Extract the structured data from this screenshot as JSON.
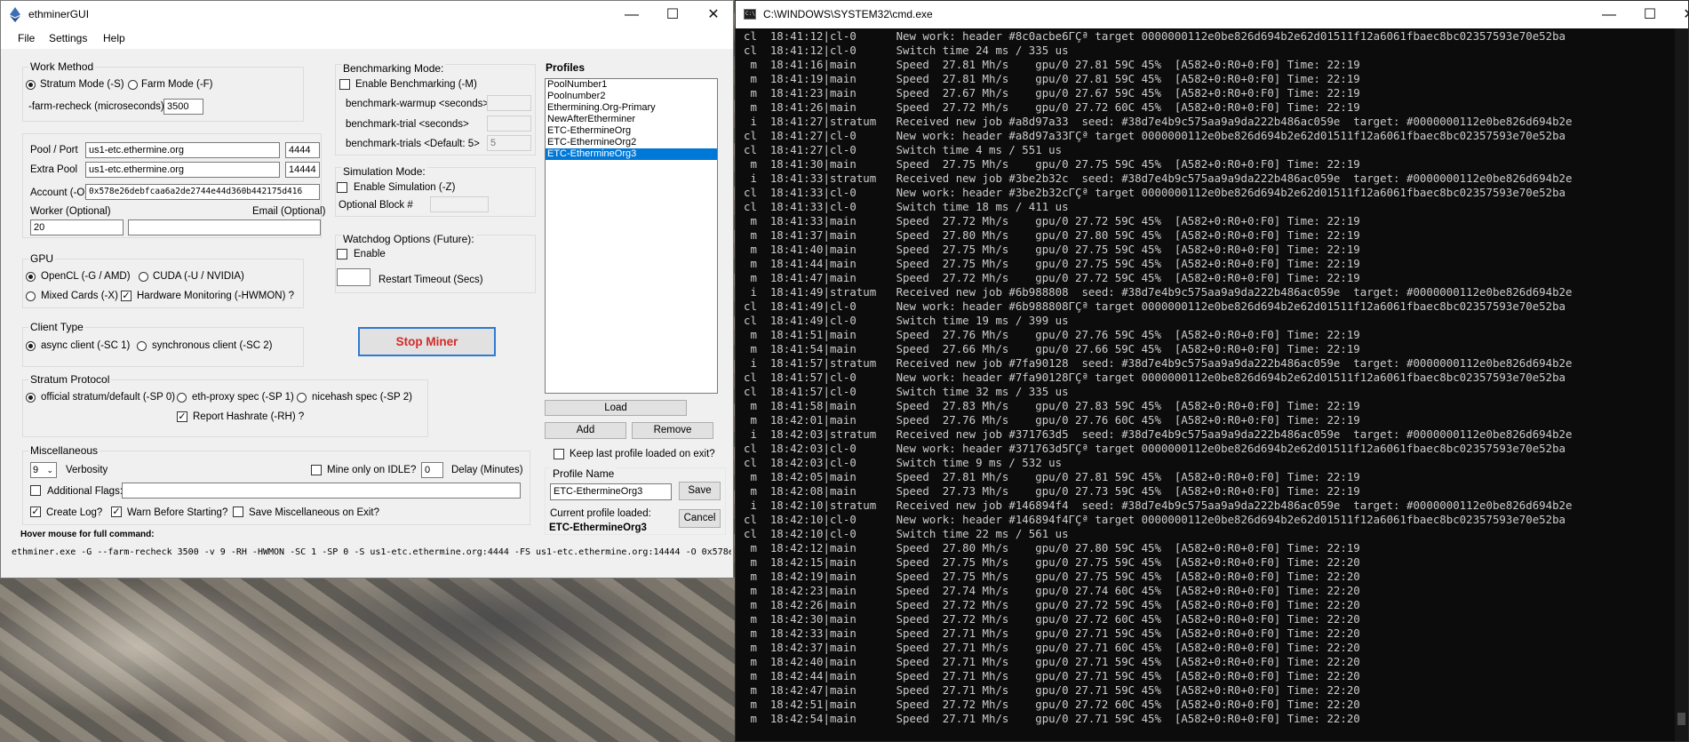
{
  "app": {
    "title": "ethminerGUI",
    "menu": [
      "File",
      "Settings",
      "Help"
    ],
    "window_buttons": {
      "minimize": "—",
      "maximize": "☐",
      "close": "✕"
    }
  },
  "work_method": {
    "title": "Work Method",
    "stratum_label": "Stratum Mode (-S)",
    "stratum_selected": true,
    "farm_label": "Farm Mode (-F)",
    "farm_selected": false,
    "recheck_label": "-farm-recheck (microseconds)",
    "recheck_value": "3500"
  },
  "pool": {
    "pool_label": "Pool / Port",
    "pool_value": "us1-etc.ethermine.org",
    "pool_port": "4444",
    "extra_label": "Extra Pool",
    "extra_value": "us1-etc.ethermine.org",
    "extra_port": "14444",
    "account_label": "Account (-O)",
    "account_value": "0x578e26debfcaa6a2de2744e44d360b442175d416",
    "worker_label": "Worker (Optional)",
    "worker_value": "20",
    "email_label": "Email (Optional)",
    "email_value": ""
  },
  "gpu": {
    "title": "GPU",
    "opencl_label": "OpenCL (-G / AMD)",
    "opencl_selected": true,
    "cuda_label": "CUDA (-U / NVIDIA)",
    "cuda_selected": false,
    "mixed_label": "Mixed Cards (-X)",
    "mixed_selected": false,
    "hwmon_label": "Hardware Monitoring (-HWMON) ?",
    "hwmon_checked": true
  },
  "client_type": {
    "title": "Client Type",
    "async_label": "async client (-SC 1)",
    "async_selected": true,
    "sync_label": "synchronous client (-SC 2)",
    "sync_selected": false
  },
  "stratum_protocol": {
    "title": "Stratum Protocol",
    "official_label": "official stratum/default (-SP 0)",
    "official_selected": true,
    "ethproxy_label": "eth-proxy spec (-SP 1)",
    "nicehash_label": "nicehash spec (-SP 2)",
    "report_label": "Report Hashrate (-RH) ?",
    "report_checked": true
  },
  "misc": {
    "title": "Miscellaneous",
    "verbosity_value": "9",
    "verbosity_label": "Verbosity",
    "idle_label": "Mine only on IDLE?",
    "idle_checked": false,
    "delay_value": "0",
    "delay_label": "Delay (Minutes)",
    "flags_label": "Additional Flags:",
    "flags_checked": false,
    "flags_value": "",
    "createlog_label": "Create Log?",
    "createlog_checked": true,
    "warn_label": "Warn Before Starting?",
    "warn_checked": true,
    "savemisc_label": "Save Miscellaneous on Exit?",
    "savemisc_checked": false
  },
  "benchmark": {
    "title": "Benchmarking Mode:",
    "enable_label": "Enable Benchmarking (-M)",
    "enable_checked": false,
    "warmup_label": "benchmark-warmup <seconds>",
    "warmup_value": "",
    "trial_label": "benchmark-trial <seconds>",
    "trial_value": "",
    "trials_label": "benchmark-trials <Default: 5>",
    "trials_value": "5"
  },
  "simulation": {
    "title": "Simulation Mode:",
    "enable_label": "Enable Simulation (-Z)",
    "enable_checked": false,
    "block_label": "Optional Block #",
    "block_value": ""
  },
  "watchdog": {
    "title": "Watchdog Options (Future):",
    "enable_label": "Enable",
    "enable_checked": false,
    "timeout_value": "",
    "timeout_label": "Restart Timeout (Secs)"
  },
  "stop_button": "Stop Miner",
  "profiles": {
    "title": "Profiles",
    "items": [
      "PoolNumber1",
      "Poolnumber2",
      "Ethermining.Org-Primary",
      "NewAfterEtherminer",
      "ETC-EthermineOrg",
      "ETC-EthermineOrg2",
      "ETC-EthermineOrg3"
    ],
    "selected_index": 6,
    "load_label": "Load",
    "add_label": "Add",
    "remove_label": "Remove",
    "keeplast_label": "Keep last profile loaded on exit?",
    "keeplast_checked": false,
    "name_title": "Profile Name",
    "name_value": "ETC-EthermineOrg3",
    "save_label": "Save",
    "current_label": "Current profile loaded:",
    "current_value": "ETC-EthermineOrg3",
    "cancel_label": "Cancel"
  },
  "hover_hint": "Hover mouse for full command:",
  "command_line": "ethminer.exe -G --farm-recheck 3500 -v 9 -RH -HWMON -SC 1 -SP 0 -S us1-etc.ethermine.org:4444 -FS us1-etc.ethermine.org:14444 -O 0x578e2",
  "cmd": {
    "title": "C:\\WINDOWS\\SYSTEM32\\cmd.exe",
    "lines": [
      "cl  18:41:12|cl-0      New work: header #8c0acbe6ГÇª target 0000000112e0be826d694b2e62d01511f12a6061fbaec8bc02357593e70e52ba",
      "cl  18:41:12|cl-0      Switch time 24 ms / 335 us",
      " m  18:41:16|main      Speed  27.81 Mh/s    gpu/0 27.81 59C 45%  [A582+0:R0+0:F0] Time: 22:19",
      " m  18:41:19|main      Speed  27.81 Mh/s    gpu/0 27.81 59C 45%  [A582+0:R0+0:F0] Time: 22:19",
      " m  18:41:23|main      Speed  27.67 Mh/s    gpu/0 27.67 59C 45%  [A582+0:R0+0:F0] Time: 22:19",
      " m  18:41:26|main      Speed  27.72 Mh/s    gpu/0 27.72 60C 45%  [A582+0:R0+0:F0] Time: 22:19",
      " i  18:41:27|stratum   Received new job #a8d97a33  seed: #38d7e4b9c575aa9a9da222b486ac059e  target: #0000000112e0be826d694b2e",
      "cl  18:41:27|cl-0      New work: header #a8d97a33ГÇª target 0000000112e0be826d694b2e62d01511f12a6061fbaec8bc02357593e70e52ba",
      "cl  18:41:27|cl-0      Switch time 4 ms / 551 us",
      " m  18:41:30|main      Speed  27.75 Mh/s    gpu/0 27.75 59C 45%  [A582+0:R0+0:F0] Time: 22:19",
      " i  18:41:33|stratum   Received new job #3be2b32c  seed: #38d7e4b9c575aa9a9da222b486ac059e  target: #0000000112e0be826d694b2e",
      "cl  18:41:33|cl-0      New work: header #3be2b32cГÇª target 0000000112e0be826d694b2e62d01511f12a6061fbaec8bc02357593e70e52ba",
      "cl  18:41:33|cl-0      Switch time 18 ms / 411 us",
      " m  18:41:33|main      Speed  27.72 Mh/s    gpu/0 27.72 59C 45%  [A582+0:R0+0:F0] Time: 22:19",
      " m  18:41:37|main      Speed  27.80 Mh/s    gpu/0 27.80 59C 45%  [A582+0:R0+0:F0] Time: 22:19",
      " m  18:41:40|main      Speed  27.75 Mh/s    gpu/0 27.75 59C 45%  [A582+0:R0+0:F0] Time: 22:19",
      " m  18:41:44|main      Speed  27.75 Mh/s    gpu/0 27.75 59C 45%  [A582+0:R0+0:F0] Time: 22:19",
      " m  18:41:47|main      Speed  27.72 Mh/s    gpu/0 27.72 59C 45%  [A582+0:R0+0:F0] Time: 22:19",
      " i  18:41:49|stratum   Received new job #6b988808  seed: #38d7e4b9c575aa9a9da222b486ac059e  target: #0000000112e0be826d694b2e",
      "cl  18:41:49|cl-0      New work: header #6b988808ГÇª target 0000000112e0be826d694b2e62d01511f12a6061fbaec8bc02357593e70e52ba",
      "cl  18:41:49|cl-0      Switch time 19 ms / 399 us",
      " m  18:41:51|main      Speed  27.76 Mh/s    gpu/0 27.76 59C 45%  [A582+0:R0+0:F0] Time: 22:19",
      " m  18:41:54|main      Speed  27.66 Mh/s    gpu/0 27.66 59C 45%  [A582+0:R0+0:F0] Time: 22:19",
      " i  18:41:57|stratum   Received new job #7fa90128  seed: #38d7e4b9c575aa9a9da222b486ac059e  target: #0000000112e0be826d694b2e",
      "cl  18:41:57|cl-0      New work: header #7fa90128ГÇª target 0000000112e0be826d694b2e62d01511f12a6061fbaec8bc02357593e70e52ba",
      "cl  18:41:57|cl-0      Switch time 32 ms / 335 us",
      " m  18:41:58|main      Speed  27.83 Mh/s    gpu/0 27.83 59C 45%  [A582+0:R0+0:F0] Time: 22:19",
      " m  18:42:01|main      Speed  27.76 Mh/s    gpu/0 27.76 60C 45%  [A582+0:R0+0:F0] Time: 22:19",
      " i  18:42:03|stratum   Received new job #371763d5  seed: #38d7e4b9c575aa9a9da222b486ac059e  target: #0000000112e0be826d694b2e",
      "cl  18:42:03|cl-0      New work: header #371763d5ГÇª target 0000000112e0be826d694b2e62d01511f12a6061fbaec8bc02357593e70e52ba",
      "cl  18:42:03|cl-0      Switch time 9 ms / 532 us",
      " m  18:42:05|main      Speed  27.81 Mh/s    gpu/0 27.81 59C 45%  [A582+0:R0+0:F0] Time: 22:19",
      " m  18:42:08|main      Speed  27.73 Mh/s    gpu/0 27.73 59C 45%  [A582+0:R0+0:F0] Time: 22:19",
      " i  18:42:10|stratum   Received new job #146894f4  seed: #38d7e4b9c575aa9a9da222b486ac059e  target: #0000000112e0be826d694b2e",
      "cl  18:42:10|cl-0      New work: header #146894f4ГÇª target 0000000112e0be826d694b2e62d01511f12a6061fbaec8bc02357593e70e52ba",
      "cl  18:42:10|cl-0      Switch time 22 ms / 561 us",
      " m  18:42:12|main      Speed  27.80 Mh/s    gpu/0 27.80 59C 45%  [A582+0:R0+0:F0] Time: 22:19",
      " m  18:42:15|main      Speed  27.75 Mh/s    gpu/0 27.75 59C 45%  [A582+0:R0+0:F0] Time: 22:20",
      " m  18:42:19|main      Speed  27.75 Mh/s    gpu/0 27.75 59C 45%  [A582+0:R0+0:F0] Time: 22:20",
      " m  18:42:23|main      Speed  27.74 Mh/s    gpu/0 27.74 60C 45%  [A582+0:R0+0:F0] Time: 22:20",
      " m  18:42:26|main      Speed  27.72 Mh/s    gpu/0 27.72 59C 45%  [A582+0:R0+0:F0] Time: 22:20",
      " m  18:42:30|main      Speed  27.72 Mh/s    gpu/0 27.72 60C 45%  [A582+0:R0+0:F0] Time: 22:20",
      " m  18:42:33|main      Speed  27.71 Mh/s    gpu/0 27.71 59C 45%  [A582+0:R0+0:F0] Time: 22:20",
      " m  18:42:37|main      Speed  27.71 Mh/s    gpu/0 27.71 60C 45%  [A582+0:R0+0:F0] Time: 22:20",
      " m  18:42:40|main      Speed  27.71 Mh/s    gpu/0 27.71 59C 45%  [A582+0:R0+0:F0] Time: 22:20",
      " m  18:42:44|main      Speed  27.71 Mh/s    gpu/0 27.71 59C 45%  [A582+0:R0+0:F0] Time: 22:20",
      " m  18:42:47|main      Speed  27.71 Mh/s    gpu/0 27.71 59C 45%  [A582+0:R0+0:F0] Time: 22:20",
      " m  18:42:51|main      Speed  27.72 Mh/s    gpu/0 27.72 60C 45%  [A582+0:R0+0:F0] Time: 22:20",
      " m  18:42:54|main      Speed  27.71 Mh/s    gpu/0 27.71 59C 45%  [A582+0:R0+0:F0] Time: 22:20"
    ]
  },
  "colors": {
    "accent": "#0078d7",
    "stop_text": "#d42a2a",
    "console_bg": "#0c0c0c",
    "console_text": "#cccccc"
  }
}
